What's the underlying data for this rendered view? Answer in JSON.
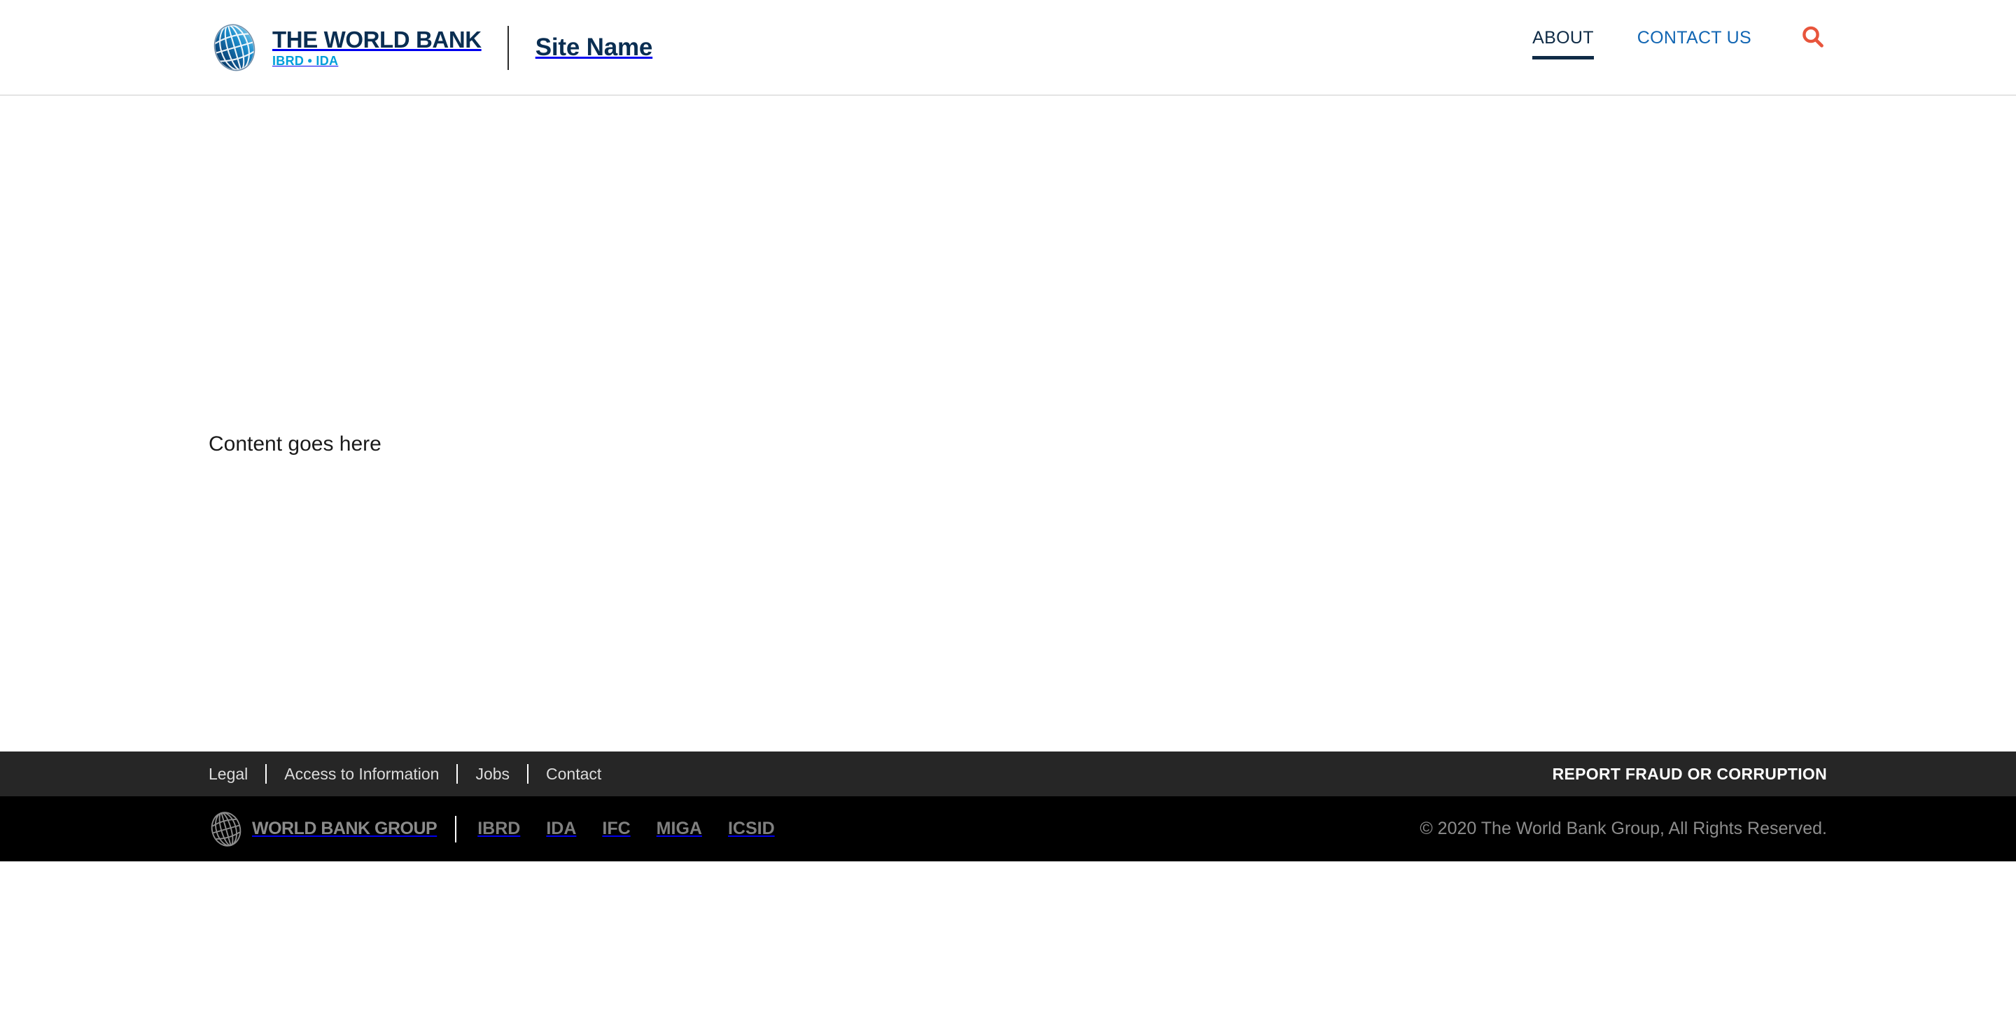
{
  "header": {
    "logo": {
      "mark_icon": "world-bank-globe-icon",
      "wordmark": "THE WORLD BANK",
      "sub_wordmark": "IBRD • IDA"
    },
    "site_name": "Site Name",
    "nav": [
      {
        "label": "ABOUT",
        "active": true
      },
      {
        "label": "CONTACT US",
        "active": false
      }
    ],
    "search": {
      "icon": "search-icon",
      "color": "#e8553c"
    },
    "colors": {
      "navy": "#0a2e52",
      "link_blue": "#1266b3",
      "cyan": "#009fda",
      "border": "#e4e4e4"
    }
  },
  "main": {
    "body_text": "Content goes here"
  },
  "footer": {
    "links_bar": {
      "background": "#262626",
      "links": [
        {
          "label": "Legal"
        },
        {
          "label": "Access to Information"
        },
        {
          "label": "Jobs"
        },
        {
          "label": "Contact"
        }
      ],
      "report_fraud_label": "REPORT FRAUD OR CORRUPTION"
    },
    "bottom_bar": {
      "background": "#000000",
      "logo": {
        "mark_icon": "world-bank-group-globe-icon",
        "wordmark": "WORLD BANK GROUP"
      },
      "institutions": [
        {
          "label": "IBRD"
        },
        {
          "label": "IDA"
        },
        {
          "label": "IFC"
        },
        {
          "label": "MIGA"
        },
        {
          "label": "ICSID"
        }
      ],
      "copyright": "© 2020 The World Bank Group, All Rights Reserved."
    }
  }
}
